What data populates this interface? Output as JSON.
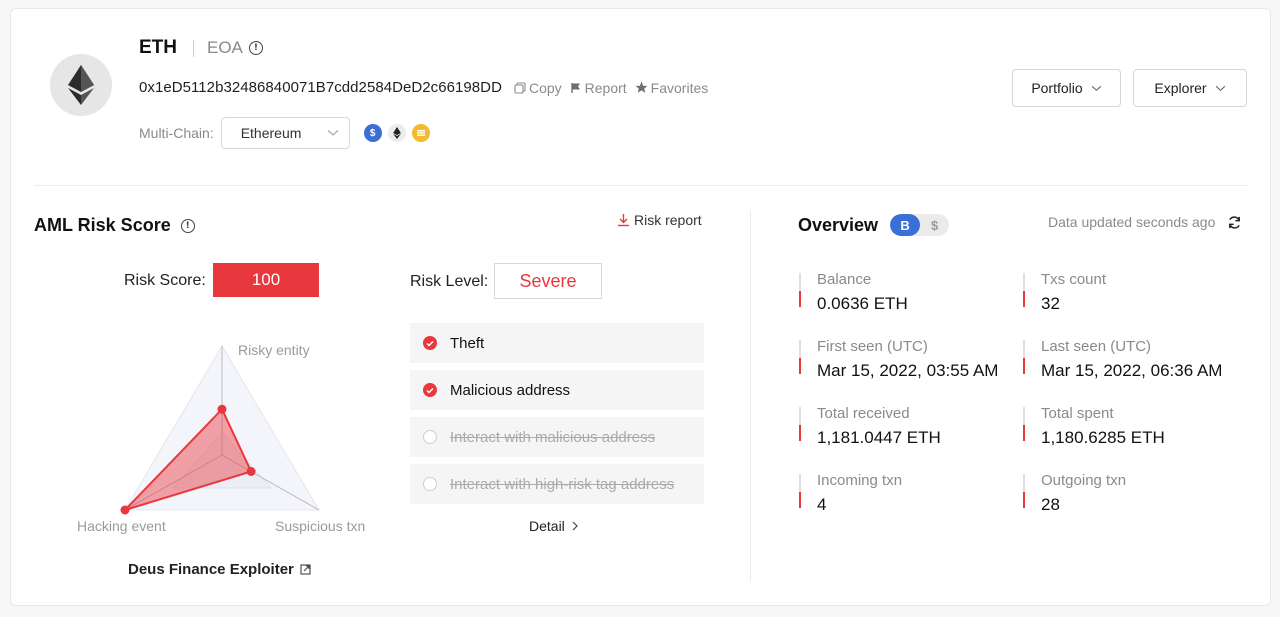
{
  "header": {
    "token": "ETH",
    "account_type": "EOA",
    "address": "0x1eD5112b32486840071B7cdd2584DeD2c66198DD",
    "actions": {
      "copy": "Copy",
      "report": "Report",
      "favorites": "Favorites"
    },
    "multichain_label": "Multi-Chain:",
    "selected_chain": "Ethereum",
    "portfolio": "Portfolio",
    "explorer": "Explorer"
  },
  "aml": {
    "title": "AML Risk Score",
    "risk_report": "Risk report",
    "score_label": "Risk Score:",
    "score": "100",
    "level_label": "Risk Level:",
    "level": "Severe",
    "radar": {
      "labels": [
        "Risky entity",
        "Suspicious txn",
        "Hacking event"
      ],
      "values": [
        0.42,
        0.3,
        1.0
      ]
    },
    "entity": "Deus Finance Exploiter",
    "items": [
      {
        "label": "Theft",
        "active": true
      },
      {
        "label": "Malicious address",
        "active": true
      },
      {
        "label": "Interact with malicious address",
        "active": false
      },
      {
        "label": "Interact with high-risk tag address",
        "active": false
      }
    ],
    "detail": "Detail"
  },
  "overview": {
    "title": "Overview",
    "toggle_on": "B",
    "toggle_off": "$",
    "updated": "Data updated seconds ago",
    "stats": [
      {
        "label": "Balance",
        "value": "0.0636 ETH"
      },
      {
        "label": "Txs count",
        "value": "32"
      },
      {
        "label": "First seen (UTC)",
        "value": "Mar 15, 2022, 03:55 AM"
      },
      {
        "label": "Last seen (UTC)",
        "value": "Mar 15, 2022, 06:36 AM"
      },
      {
        "label": "Total received",
        "value": "1,181.0447 ETH"
      },
      {
        "label": "Total spent",
        "value": "1,180.6285 ETH"
      },
      {
        "label": "Incoming txn",
        "value": "4"
      },
      {
        "label": "Outgoing txn",
        "value": "28"
      }
    ]
  },
  "colors": {
    "accent_red": "#e8383d",
    "accent_blue": "#3a6fd6"
  }
}
